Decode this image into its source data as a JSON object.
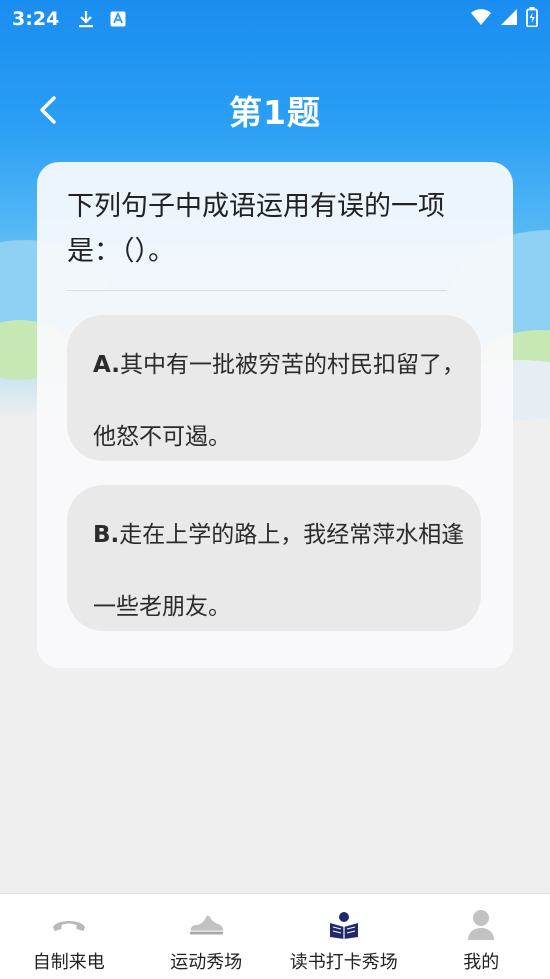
{
  "status_bar": {
    "time": "3:24",
    "left_icons": [
      "download-icon",
      "font-a-icon"
    ],
    "right_icons": [
      "wifi-icon",
      "signal-icon",
      "battery-icon"
    ]
  },
  "header": {
    "title": "第1题",
    "back_icon": "chevron-left-icon"
  },
  "question": {
    "text": "下列句子中成语运用有误的一项是：（）。",
    "options": [
      {
        "letter": "A.",
        "text": "其中有一批被穷苦的村民扣留了，他怒不可遏。"
      },
      {
        "letter": "B.",
        "text": "走在上学的路上，我经常萍水相逢一些老朋友。"
      }
    ]
  },
  "tabbar": {
    "items": [
      {
        "label": "自制来电",
        "icon": "phone-icon",
        "active": false
      },
      {
        "label": "运动秀场",
        "icon": "sneaker-icon",
        "active": false
      },
      {
        "label": "读书打卡秀场",
        "icon": "reading-icon",
        "active": true
      },
      {
        "label": "我的",
        "icon": "user-icon",
        "active": false
      }
    ]
  },
  "colors": {
    "sky": "#2a9ff4",
    "active_tab_icon": "#1f2a6b",
    "inactive_tab_icon": "#b9b9b9"
  }
}
